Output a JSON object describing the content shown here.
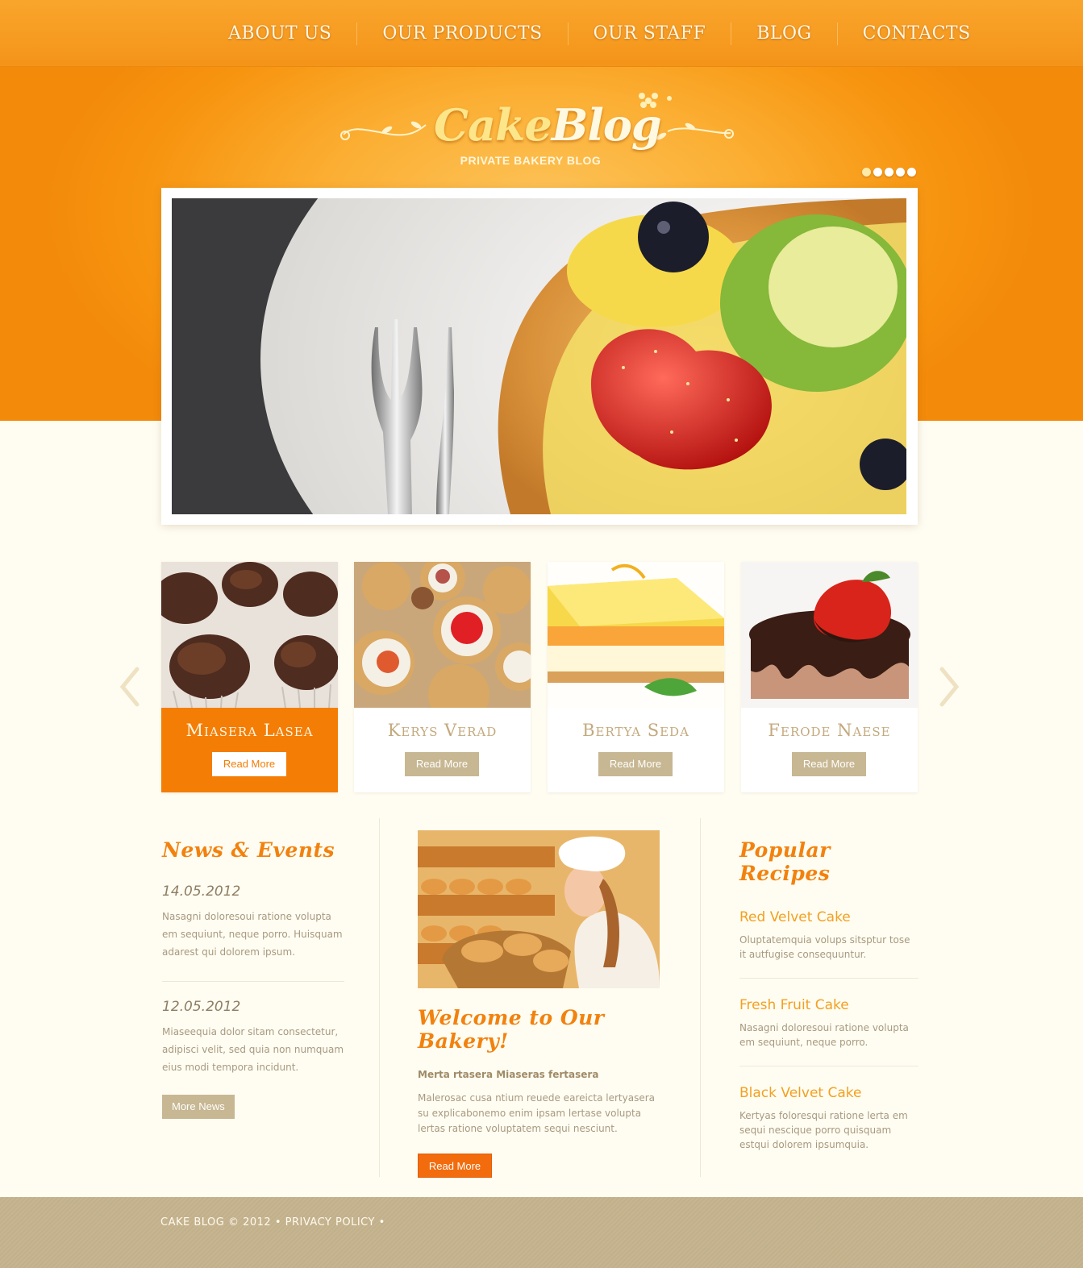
{
  "nav": {
    "items": [
      {
        "label": "ABOUT US"
      },
      {
        "label": "OUR PRODUCTS"
      },
      {
        "label": "OUR STAFF"
      },
      {
        "label": "BLOG"
      },
      {
        "label": "CONTACTS"
      }
    ]
  },
  "brand": {
    "name_part1": "Cake",
    "name_part2": "Blog",
    "tagline": "PRIVATE BAKERY BLOG"
  },
  "slider": {
    "dot_count": 5,
    "active_dot": 1
  },
  "products": [
    {
      "title": "Miasera Lasea",
      "button": "Read More",
      "active": true
    },
    {
      "title": "Kerys Verad",
      "button": "Read More",
      "active": false
    },
    {
      "title": "Bertya Seda",
      "button": "Read More",
      "active": false
    },
    {
      "title": "Ferode Naese",
      "button": "Read More",
      "active": false
    }
  ],
  "news": {
    "title": "News & Events",
    "items": [
      {
        "date": "14.05.2012",
        "text": "Nasagni doloresoui ratione volupta em sequiunt, neque porro. Huisquam adarest qui dolorem ipsum."
      },
      {
        "date": "12.05.2012",
        "text": "Miaseequia dolor sitam consectetur, adipisci velit, sed quia non numquam eius modi tempora incidunt."
      }
    ],
    "more_button": "More News"
  },
  "welcome": {
    "title": "Welcome to Our Bakery!",
    "subtitle": "Merta rtasera Miaseras fertasera",
    "text": "Malerosac cusa ntium reuede eareicta lertyasera su explicabonemo enim ipsam lertase volupta lertas ratione voluptatem sequi nesciunt.",
    "button": "Read More"
  },
  "recipes": {
    "title": "Popular Recipes",
    "items": [
      {
        "name": "Red Velvet Cake",
        "text": "Oluptatemquia volups sitsptur tose it autfugise consequuntur."
      },
      {
        "name": "Fresh Fruit Cake",
        "text": "Nasagni doloresoui ratione volupta em sequiunt, neque porro."
      },
      {
        "name": "Black Velvet Cake",
        "text": "Kertyas foloresqui ratione lerta em sequi nescique porro quisquam estqui dolorem ipsumquia."
      }
    ]
  },
  "footer": {
    "copyright": "CAKE BLOG © 2012",
    "separator": "•",
    "privacy": "PRIVACY POLICY"
  },
  "colors": {
    "accent_orange": "#f47d05",
    "button_tan": "#c7b792",
    "heading_orange": "#f2820e",
    "recipe_link": "#f3a020"
  }
}
